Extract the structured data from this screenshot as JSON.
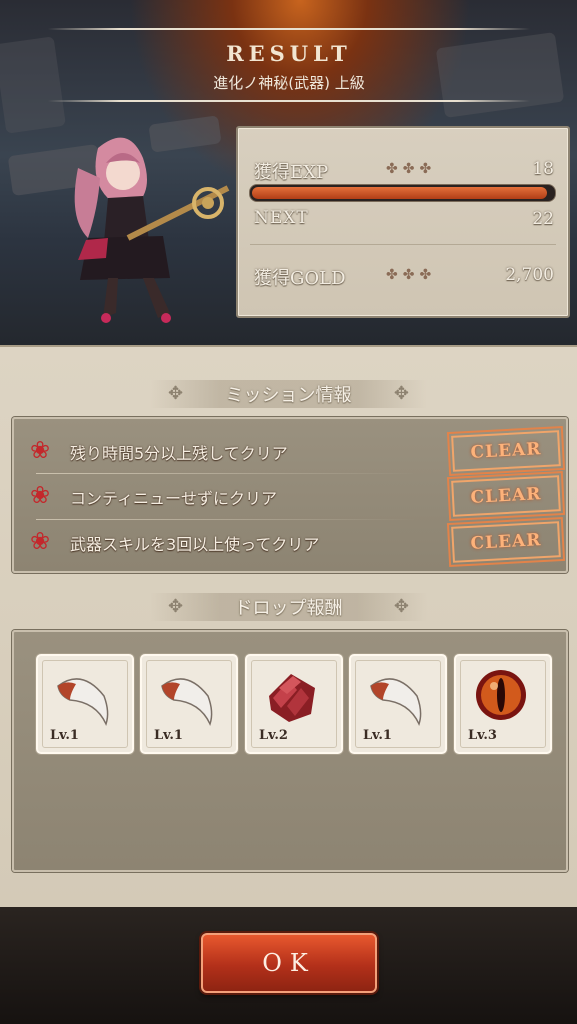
{
  "header": {
    "title": "RESULT",
    "subtitle": "進化ノ神秘(武器) 上級"
  },
  "stats": {
    "exp_label": "獲得EXP",
    "exp_value": "18",
    "exp_progress": 0.98,
    "next_label": "NEXT",
    "next_value": "22",
    "gold_label": "獲得GOLD",
    "gold_value": "2,700"
  },
  "missions": {
    "heading": "ミッション情報",
    "items": [
      {
        "text": "残り時間5分以上残してクリア",
        "status": "CLEAR"
      },
      {
        "text": "コンティニューせずにクリア",
        "status": "CLEAR"
      },
      {
        "text": "武器スキルを3回以上使ってクリア",
        "status": "CLEAR"
      }
    ]
  },
  "drops": {
    "heading": "ドロップ報酬",
    "items": [
      {
        "icon": "fang-icon",
        "level": "Lv.1"
      },
      {
        "icon": "fang-icon",
        "level": "Lv.1"
      },
      {
        "icon": "scale-icon",
        "level": "Lv.2"
      },
      {
        "icon": "fang-icon",
        "level": "Lv.1"
      },
      {
        "icon": "eye-orb-icon",
        "level": "Lv.3"
      }
    ]
  },
  "ok_label": "OK",
  "colors": {
    "accent": "#c23c1e",
    "stamp": "#f0a56a",
    "parchment": "#d8cfbf"
  }
}
